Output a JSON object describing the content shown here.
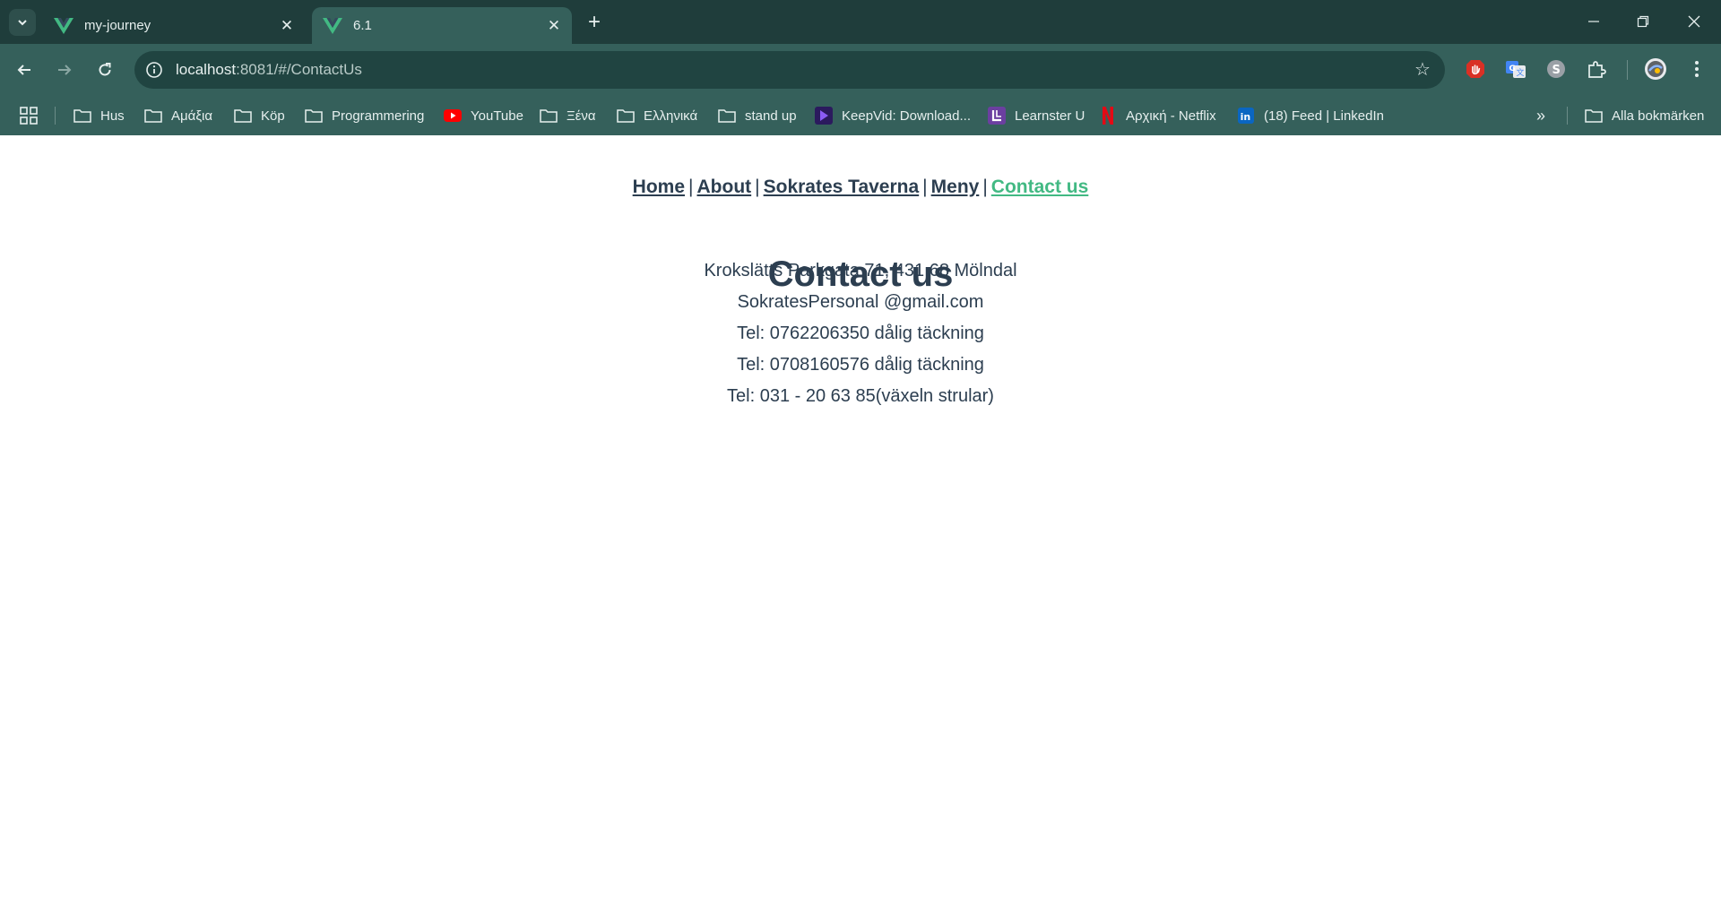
{
  "browser": {
    "tabs": [
      {
        "title": "my-journey",
        "active": false
      },
      {
        "title": "6.1",
        "active": true
      }
    ],
    "url_host": "localhost",
    "url_rest": ":8081/#/ContactUs",
    "bookmarks": [
      {
        "label": "Hus",
        "icon": "folder-icon"
      },
      {
        "label": "Αμάξια",
        "icon": "folder-icon"
      },
      {
        "label": "Köp",
        "icon": "folder-icon"
      },
      {
        "label": "Programmering",
        "icon": "folder-icon"
      },
      {
        "label": "YouTube",
        "icon": "youtube-icon"
      },
      {
        "label": "Ξένα",
        "icon": "folder-icon"
      },
      {
        "label": "Ελληνικά",
        "icon": "folder-icon"
      },
      {
        "label": "stand up",
        "icon": "folder-icon"
      },
      {
        "label": "KeepVid: Download...",
        "icon": "keepvid-icon"
      },
      {
        "label": "Learnster U",
        "icon": "learnster-icon"
      },
      {
        "label": "Αρχική - Netflix",
        "icon": "netflix-icon"
      },
      {
        "label": "(18) Feed | LinkedIn",
        "icon": "linkedin-icon"
      }
    ],
    "all_bookmarks": "Alla bokmärken",
    "colors": {
      "frame": "#1f3d3b",
      "toolbar": "#35605b",
      "omnibox": "#204441"
    }
  },
  "nav": {
    "links": [
      {
        "label": "Home",
        "active": false
      },
      {
        "label": "About",
        "active": false
      },
      {
        "label": "Sokrates Taverna",
        "active": false
      },
      {
        "label": "Meny",
        "active": false
      },
      {
        "label": "Contact us",
        "active": true
      }
    ],
    "separator": "|"
  },
  "contact": {
    "title": "Contact us",
    "address": "Krokslätts Parkgata 71, 431 68 Mölndal",
    "email": "SokratesPersonal @gmail.com",
    "phone1": "Tel: 0762206350 dålig täckning",
    "phone2": "Tel: 0708160576 dålig täckning",
    "phone3": "Tel: 031 - 20 63 85(växeln strular)"
  },
  "colors": {
    "text": "#2c3e50",
    "active_link": "#42b983"
  }
}
